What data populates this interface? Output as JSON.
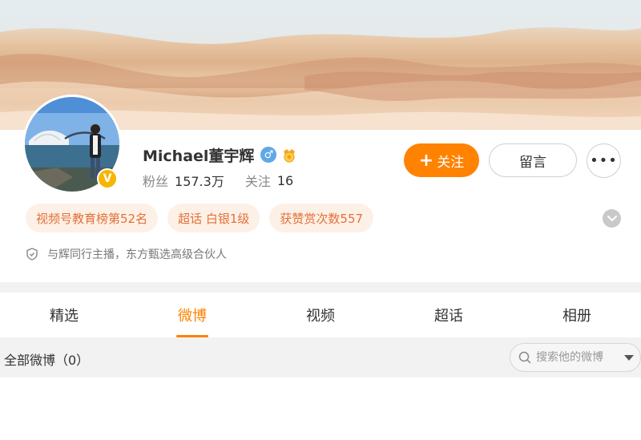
{
  "profile": {
    "name": "Michael董宇辉",
    "gender_icon": "male-icon",
    "medal_icon": "medal-icon",
    "verified_icon": "verified-badge-icon",
    "verified_symbol": "V",
    "fans_label": "粉丝",
    "fans_value": "157.3万",
    "following_label": "关注",
    "following_value": "16",
    "intro": "与辉同行主播，东方甄选高级合伙人"
  },
  "actions": {
    "follow_plus": "+",
    "follow_label": "关注",
    "message_label": "留言",
    "more_label": "•••"
  },
  "tags": [
    "视频号教育榜第52名",
    "超话 白银1级",
    "获赞赏次数557"
  ],
  "tabs": [
    {
      "label": "精选",
      "active": false
    },
    {
      "label": "微博",
      "active": true
    },
    {
      "label": "视频",
      "active": false
    },
    {
      "label": "超话",
      "active": false
    },
    {
      "label": "相册",
      "active": false
    }
  ],
  "feed": {
    "all_posts_label": "全部微博（0）",
    "search_placeholder": "搜索他的微博"
  },
  "colors": {
    "accent": "#ff8200",
    "tag_bg": "#fdf1e7",
    "tag_text": "#e4703a",
    "verified": "#f7b500",
    "gender": "#5fa8e8"
  }
}
